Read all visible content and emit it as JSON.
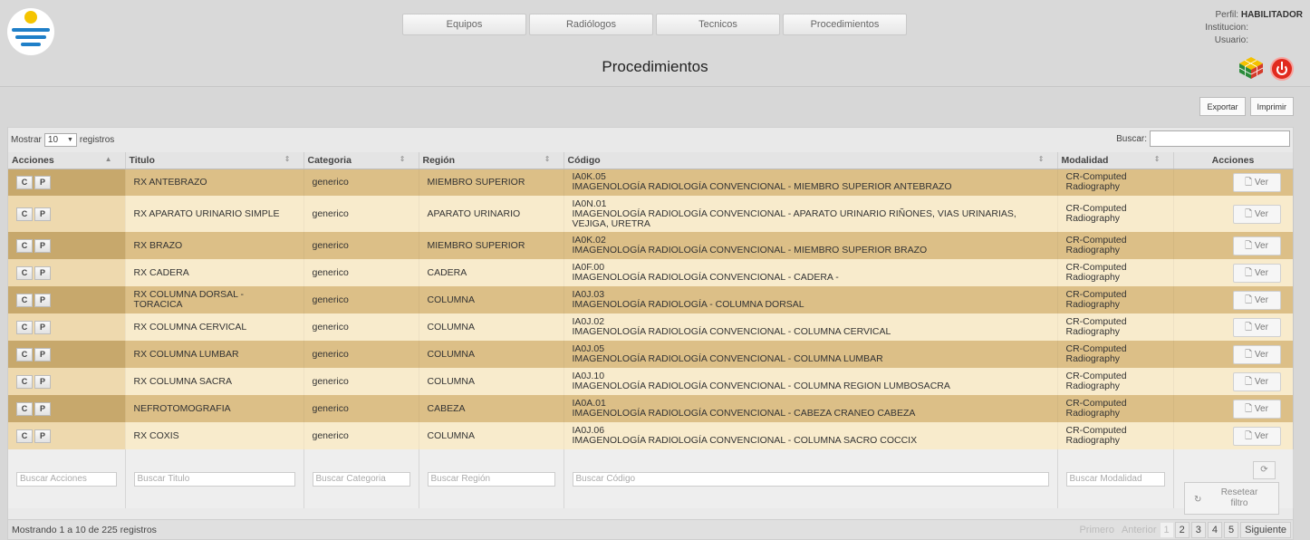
{
  "nav": [
    "Equipos",
    "Radiólogos",
    "Tecnicos",
    "Procedimientos"
  ],
  "user": {
    "perfil_label": "Perfil:",
    "perfil_value": "HABILITADOR",
    "institucion_label": "Institucion:",
    "usuario_label": "Usuario:"
  },
  "page_title": "Procedimientos",
  "toolbar": {
    "export": "Exportar",
    "print": "Imprimir"
  },
  "controls": {
    "show_label": "Mostrar",
    "show_value": "10",
    "records_label": "registros",
    "search_label": "Buscar:"
  },
  "columns": [
    "Acciones",
    "Titulo",
    "Categoria",
    "Región",
    "Código",
    "Modalidad",
    "Acciones"
  ],
  "rows": [
    {
      "titulo": "RX ANTEBRAZO",
      "categoria": "generico",
      "region": "MIEMBRO SUPERIOR",
      "codigo": "IA0K.05",
      "descripcion": "IMAGENOLOGÍA RADIOLOGÍA CONVENCIONAL - MIEMBRO SUPERIOR ANTEBRAZO",
      "modalidad": "CR-Computed Radiography"
    },
    {
      "titulo": "RX APARATO URINARIO SIMPLE",
      "categoria": "generico",
      "region": "APARATO URINARIO",
      "codigo": "IA0N.01",
      "descripcion": "IMAGENOLOGÍA RADIOLOGÍA CONVENCIONAL - APARATO URINARIO RIÑONES, VIAS URINARIAS, VEJIGA, URETRA",
      "modalidad": "CR-Computed Radiography"
    },
    {
      "titulo": "RX BRAZO",
      "categoria": "generico",
      "region": "MIEMBRO SUPERIOR",
      "codigo": "IA0K.02",
      "descripcion": "IMAGENOLOGÍA RADIOLOGÍA CONVENCIONAL - MIEMBRO SUPERIOR BRAZO",
      "modalidad": "CR-Computed Radiography"
    },
    {
      "titulo": "RX CADERA",
      "categoria": "generico",
      "region": "CADERA",
      "codigo": "IA0F.00",
      "descripcion": "IMAGENOLOGÍA RADIOLOGÍA CONVENCIONAL - CADERA -",
      "modalidad": "CR-Computed Radiography"
    },
    {
      "titulo": "RX COLUMNA DORSAL - TORACICA",
      "categoria": "generico",
      "region": "COLUMNA",
      "codigo": "IA0J.03",
      "descripcion": "IMAGENOLOGÍA RADIOLOGÍA - COLUMNA DORSAL",
      "modalidad": "CR-Computed Radiography"
    },
    {
      "titulo": "RX COLUMNA CERVICAL",
      "categoria": "generico",
      "region": "COLUMNA",
      "codigo": "IA0J.02",
      "descripcion": "IMAGENOLOGÍA RADIOLOGÍA CONVENCIONAL - COLUMNA CERVICAL",
      "modalidad": "CR-Computed Radiography"
    },
    {
      "titulo": "RX COLUMNA LUMBAR",
      "categoria": "generico",
      "region": "COLUMNA",
      "codigo": "IA0J.05",
      "descripcion": "IMAGENOLOGÍA RADIOLOGÍA CONVENCIONAL - COLUMNA LUMBAR",
      "modalidad": "CR-Computed Radiography"
    },
    {
      "titulo": "RX COLUMNA SACRA",
      "categoria": "generico",
      "region": "COLUMNA",
      "codigo": "IA0J.10",
      "descripcion": "IMAGENOLOGÍA RADIOLOGÍA CONVENCIONAL - COLUMNA REGION LUMBOSACRA",
      "modalidad": "CR-Computed Radiography"
    },
    {
      "titulo": "NEFROTOMOGRAFIA",
      "categoria": "generico",
      "region": "CABEZA",
      "codigo": "IA0A.01",
      "descripcion": "IMAGENOLOGÍA RADIOLOGÍA CONVENCIONAL - CABEZA CRANEO CABEZA",
      "modalidad": "CR-Computed Radiography"
    },
    {
      "titulo": "RX COXIS",
      "categoria": "generico",
      "region": "COLUMNA",
      "codigo": "IA0J.06",
      "descripcion": "IMAGENOLOGÍA RADIOLOGÍA CONVENCIONAL - COLUMNA SACRO COCCIX",
      "modalidad": "CR-Computed Radiography"
    }
  ],
  "row_actions": {
    "c": "C",
    "p": "P",
    "ver": "Ver"
  },
  "filters": [
    "Buscar Acciones",
    "Buscar Titulo",
    "Buscar Categoria",
    "Buscar Región",
    "Buscar Código",
    "Buscar Modalidad"
  ],
  "reset_label": "Resetear filtro",
  "footer": {
    "info": "Mostrando 1 a 10 de 225 registros",
    "first": "Primero",
    "prev": "Anterior",
    "pages": [
      "1",
      "2",
      "3",
      "4",
      "5"
    ],
    "next": "Siguiente"
  }
}
